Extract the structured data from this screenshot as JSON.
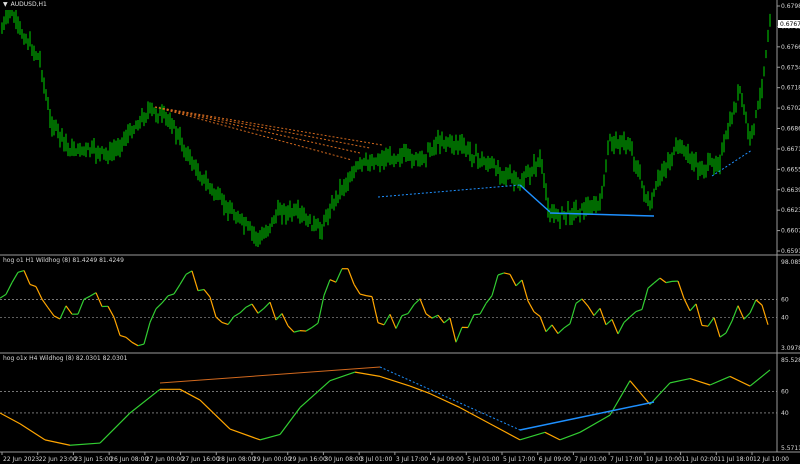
{
  "symbol": {
    "arrow": "▼",
    "name": "AUDUSD,H1"
  },
  "price_panel": {
    "axis_labels": [
      "0.67980",
      "0.67825",
      "0.67665",
      "0.67345",
      "0.67185",
      "0.67025",
      "0.66865",
      "0.66710",
      "0.66550",
      "0.66390",
      "0.66230",
      "0.66070",
      "0.65910"
    ],
    "current_price": "0.67671",
    "colors": {
      "candle": "#00d400",
      "trend_orange": "#d2691e",
      "trend_blue": "#1e90ff",
      "price_tag": "#ffffff"
    }
  },
  "indicator1": {
    "label": "hog o1 H1 Wildhog (8) 81.4249 81.4249",
    "axis_labels": [
      "98.0854",
      "60",
      "40",
      "3.0978"
    ],
    "levels": [
      60,
      40
    ],
    "range": [
      3.0978,
      98.0854
    ],
    "colors": {
      "up": "#32cd32",
      "down": "#ffa500"
    }
  },
  "indicator2": {
    "label": "hog o1x H4 Wildhog (8) 82.0301 82.0301",
    "axis_labels": [
      "85.5281",
      "60",
      "40",
      "5.5711"
    ],
    "levels": [
      60,
      40
    ],
    "range": [
      5.5711,
      85.5281
    ],
    "colors": {
      "up": "#32cd32",
      "down": "#ffa500"
    }
  },
  "time_axis": [
    "22 Jun 2023",
    "22 Jun 23:00",
    "23 Jun 15:00",
    "26 Jun 08:00",
    "27 Jun 00:00",
    "27 Jun 16:00",
    "28 Jun 08:00",
    "29 Jun 00:00",
    "29 Jun 16:00",
    "30 Jun 08:00",
    "3 Jul 01:00",
    "3 Jul 17:00",
    "4 Jul 09:00",
    "5 Jul 01:00",
    "5 Jul 17:00",
    "6 Jul 09:00",
    "7 Jul 01:00",
    "7 Jul 17:00",
    "10 Jul 10:00",
    "11 Jul 02:00",
    "11 Jul 18:00",
    "12 Jul 10:00"
  ]
}
